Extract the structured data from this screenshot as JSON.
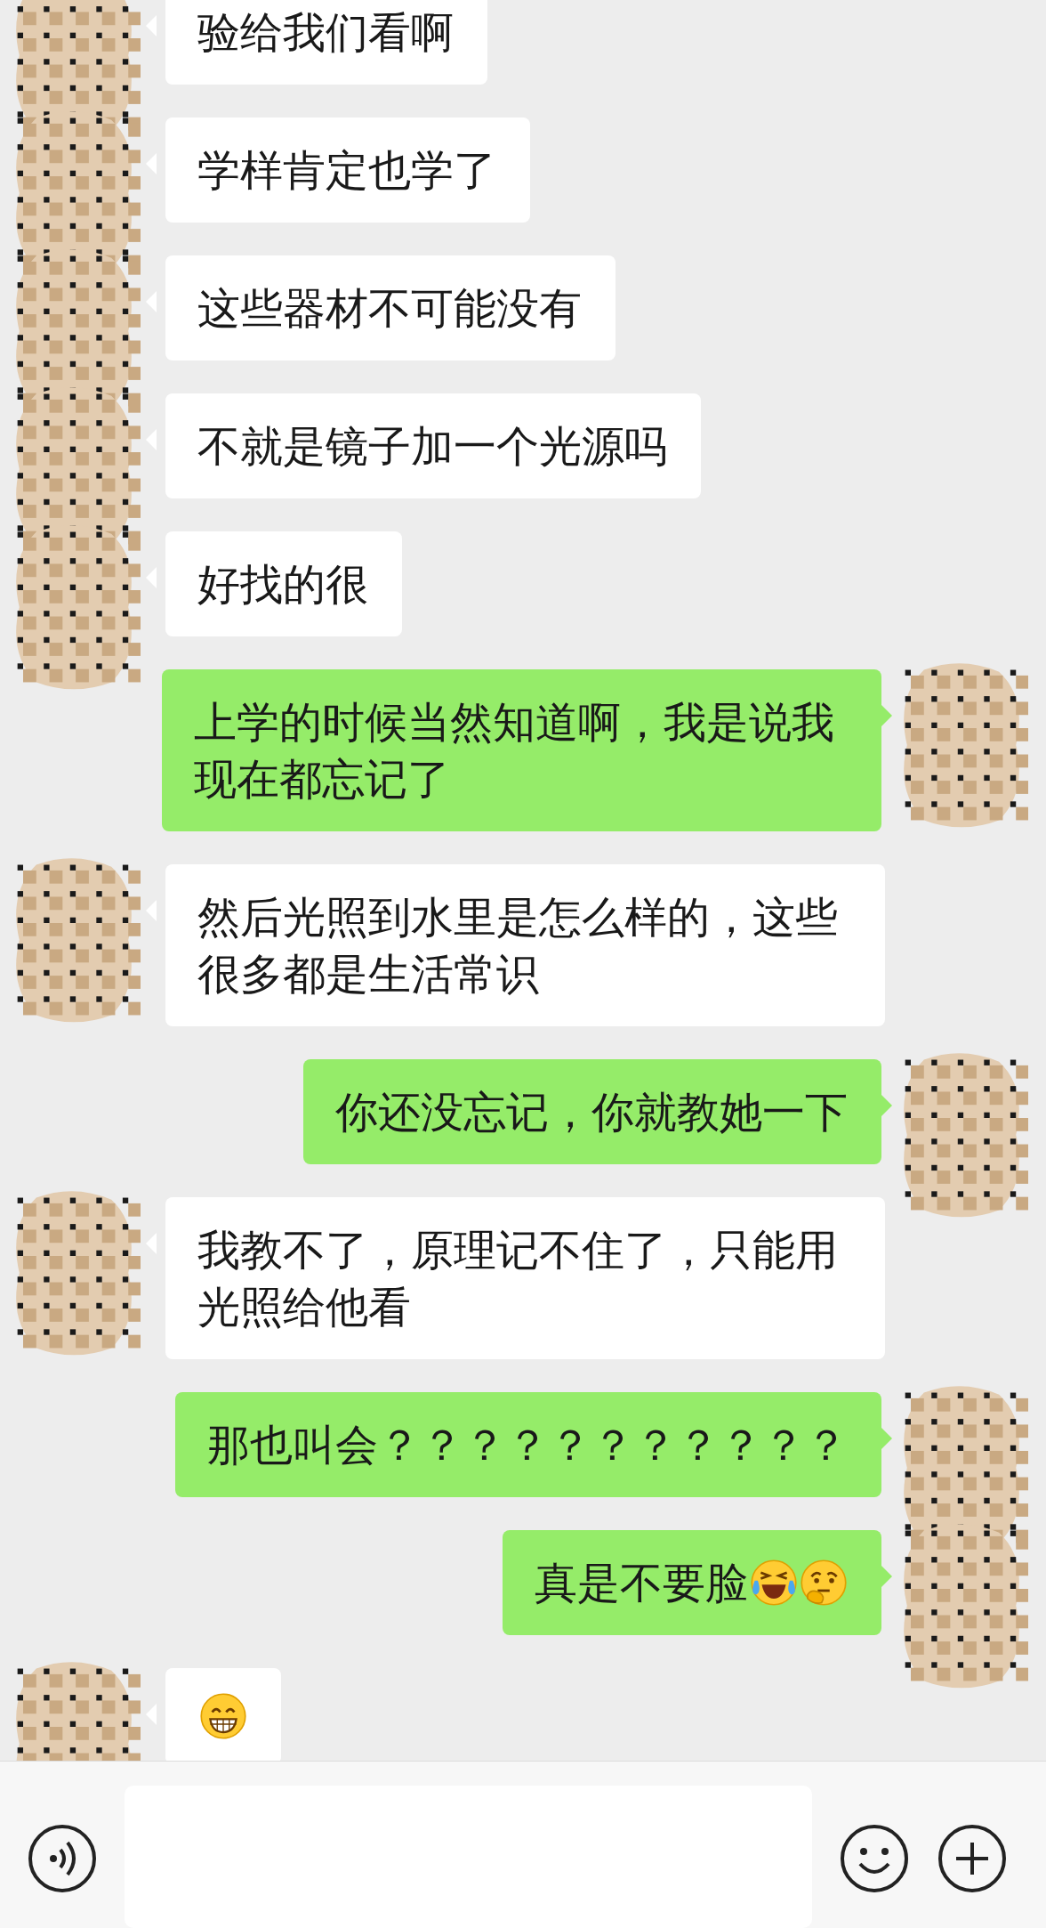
{
  "messages": [
    {
      "kind": "other",
      "text": "验给我们看啊"
    },
    {
      "kind": "other",
      "text": "学样肯定也学了"
    },
    {
      "kind": "other",
      "text": "这些器材不可能没有"
    },
    {
      "kind": "other",
      "text": "不就是镜子加一个光源吗"
    },
    {
      "kind": "other",
      "text": "好找的很"
    },
    {
      "kind": "me",
      "text": "上学的时候当然知道啊，我是说我现在都忘记了"
    },
    {
      "kind": "other",
      "text": "然后光照到水里是怎么样的，这些很多都是生活常识"
    },
    {
      "kind": "me",
      "text": "你还没忘记，你就教她一下"
    },
    {
      "kind": "other",
      "text": "我教不了，原理记不住了，只能用光照给他看"
    },
    {
      "kind": "me",
      "text": "那也叫会？？？？？？？？？？？"
    },
    {
      "kind": "me",
      "text": "真是不要脸",
      "emojis": [
        {
          "kind": "tears-of-joy"
        },
        {
          "kind": "thinking"
        }
      ]
    },
    {
      "kind": "other",
      "emojis": [
        {
          "kind": "grin"
        }
      ]
    }
  ]
}
